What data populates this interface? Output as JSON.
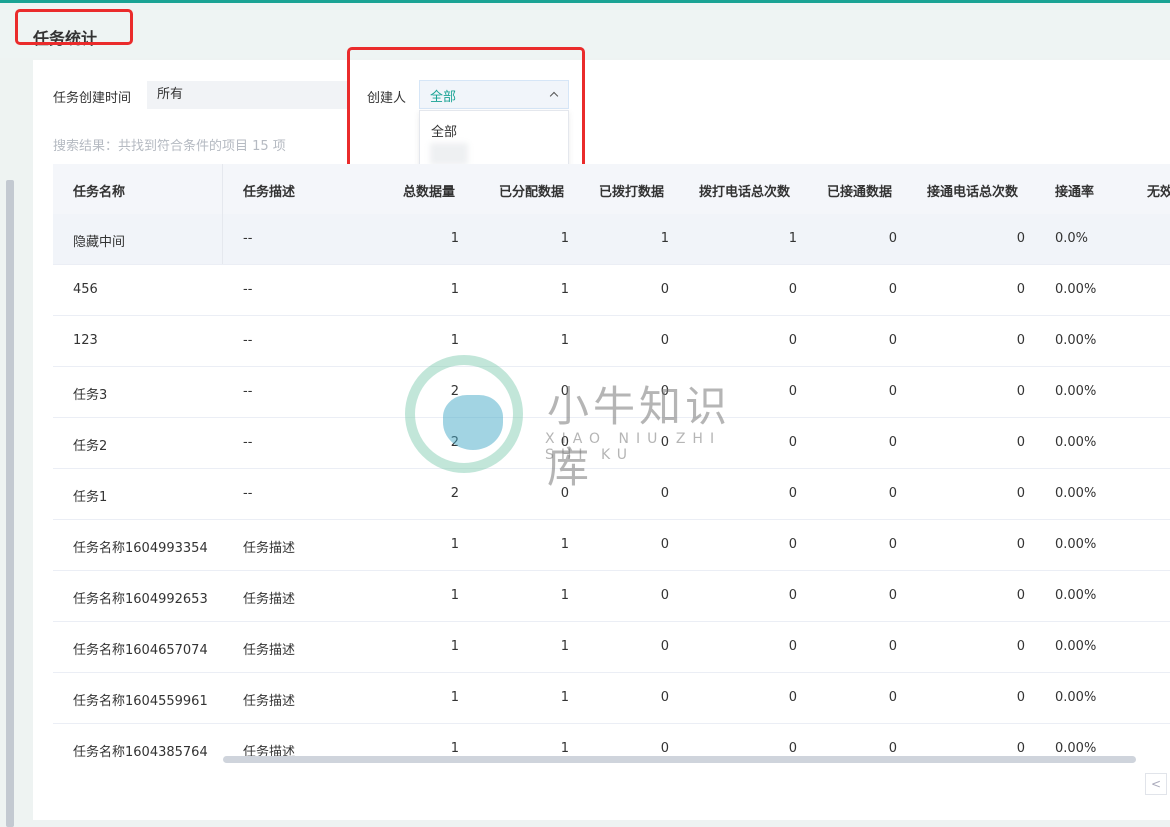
{
  "page": {
    "title": "任务统计"
  },
  "filters": {
    "create_time_label": "任务创建时间",
    "create_time_value": "所有",
    "creator_label": "创建人",
    "creator_value": "全部",
    "creator_options": [
      "全部"
    ]
  },
  "search_result": "搜索结果：共找到符合条件的项目 15 项",
  "table": {
    "columns": [
      "任务名称",
      "任务描述",
      "总数据量",
      "已分配数据",
      "已拨打数据",
      "拨打电话总次数",
      "已接通数据",
      "接通电话总次数",
      "接通率",
      "无效"
    ],
    "rows": [
      {
        "name": "隐藏中间",
        "desc": "--",
        "total": "1",
        "assigned": "1",
        "dialed": "1",
        "calls": "1",
        "connected": "0",
        "conn_calls": "0",
        "rate": "0.0%"
      },
      {
        "name": "456",
        "desc": "--",
        "total": "1",
        "assigned": "1",
        "dialed": "0",
        "calls": "0",
        "connected": "0",
        "conn_calls": "0",
        "rate": "0.00%"
      },
      {
        "name": "123",
        "desc": "--",
        "total": "1",
        "assigned": "1",
        "dialed": "0",
        "calls": "0",
        "connected": "0",
        "conn_calls": "0",
        "rate": "0.00%"
      },
      {
        "name": "任务3",
        "desc": "--",
        "total": "2",
        "assigned": "0",
        "dialed": "0",
        "calls": "0",
        "connected": "0",
        "conn_calls": "0",
        "rate": "0.00%"
      },
      {
        "name": "任务2",
        "desc": "--",
        "total": "2",
        "assigned": "0",
        "dialed": "0",
        "calls": "0",
        "connected": "0",
        "conn_calls": "0",
        "rate": "0.00%"
      },
      {
        "name": "任务1",
        "desc": "--",
        "total": "2",
        "assigned": "0",
        "dialed": "0",
        "calls": "0",
        "connected": "0",
        "conn_calls": "0",
        "rate": "0.00%"
      },
      {
        "name": "任务名称1604993354",
        "desc": "任务描述",
        "total": "1",
        "assigned": "1",
        "dialed": "0",
        "calls": "0",
        "connected": "0",
        "conn_calls": "0",
        "rate": "0.00%"
      },
      {
        "name": "任务名称1604992653",
        "desc": "任务描述",
        "total": "1",
        "assigned": "1",
        "dialed": "0",
        "calls": "0",
        "connected": "0",
        "conn_calls": "0",
        "rate": "0.00%"
      },
      {
        "name": "任务名称1604657074",
        "desc": "任务描述",
        "total": "1",
        "assigned": "1",
        "dialed": "0",
        "calls": "0",
        "connected": "0",
        "conn_calls": "0",
        "rate": "0.00%"
      },
      {
        "name": "任务名称1604559961",
        "desc": "任务描述",
        "total": "1",
        "assigned": "1",
        "dialed": "0",
        "calls": "0",
        "connected": "0",
        "conn_calls": "0",
        "rate": "0.00%"
      },
      {
        "name": "任务名称1604385764",
        "desc": "任务描述",
        "total": "1",
        "assigned": "1",
        "dialed": "0",
        "calls": "0",
        "connected": "0",
        "conn_calls": "0",
        "rate": "0.00%"
      }
    ]
  },
  "pager": {
    "prev_symbol": "<"
  },
  "watermark": {
    "text": "小牛知识库",
    "sub": "XIAO NIU ZHI SHI KU"
  },
  "colors": {
    "accent": "#1aa394",
    "highlight": "#ea2b2b"
  }
}
